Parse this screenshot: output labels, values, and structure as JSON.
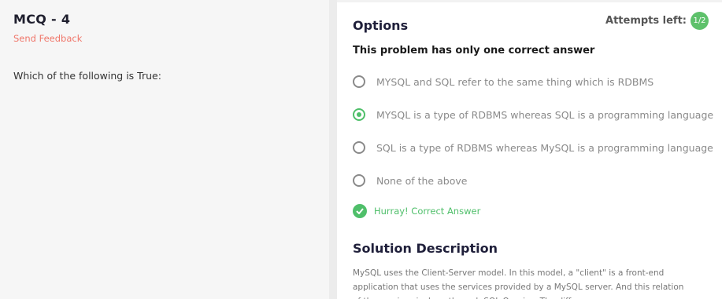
{
  "problem": {
    "title": "MCQ - 4",
    "feedback_link": "Send Feedback",
    "question": "Which of the following is True:"
  },
  "options_panel": {
    "title": "Options",
    "attempts_label": "Attempts left:",
    "attempts_value": "1/2",
    "instruction": "This problem has only one correct answer",
    "options": [
      {
        "label": "MYSQL and SQL refer to the same thing which is RDBMS",
        "selected": false
      },
      {
        "label": "MYSQL is a type of RDBMS whereas SQL is a programming language",
        "selected": true
      },
      {
        "label": "SQL is a type of RDBMS whereas MySQL is a programming language",
        "selected": false
      },
      {
        "label": "None of the above",
        "selected": false
      }
    ],
    "result_text": "Hurray! Correct Answer",
    "result_icon": "check-circle-icon",
    "accent_color": "#4fbf6a"
  },
  "solution": {
    "title": "Solution Description",
    "text": "MySQL uses the Client-Server model. In this model, a \"client\" is a front-end application that uses the services provided by a MySQL server. And this relation of the services is done through SQL Queries. The diff"
  }
}
